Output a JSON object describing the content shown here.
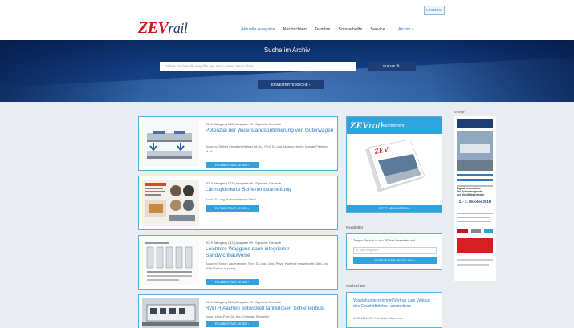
{
  "header": {
    "login_label": "LOGIN ≫",
    "logo_zev": "ZEV",
    "logo_rail": "rail",
    "nav": [
      {
        "label": "Aktuelle Ausgabe"
      },
      {
        "label": "Nachrichten"
      },
      {
        "label": "Termine"
      },
      {
        "label": "Sonderhefte"
      },
      {
        "label": "Service ⌄"
      },
      {
        "label": "Archiv ›"
      }
    ]
  },
  "hero": {
    "title": "Suche im Archiv",
    "search_placeholder": "Geben Sie hier die Begriffe ein, nach denen Sie suchen",
    "search_button": "SUCHE 🔍",
    "advanced_button": "ERWEITERTE SUCHE ›"
  },
  "articles": [
    {
      "meta": "2019 Jahrgang 143 | Ausgabe 09 | Sprache: Deutsch",
      "title": "Potenzial der Widerstandsoptimierung von Güterwagen",
      "authors": "Autoren: Stefan Christian Hellwig, M.Sc.; Prof. Dr.-Ing. Markus Hecht; Marian Fleming, M.Sc.",
      "button": "FACHBEITRAG LESEN ›"
    },
    {
      "meta": "2019 Jahrgang 143 | Ausgabe 09 | Sprache: Deutsch",
      "title": "Lärmoptimierte Schienenbearbeitung",
      "authors": "Autor: Dr.-Ing. Konstantin von Diest",
      "button": "FACHBEITRAG LESEN ›"
    },
    {
      "meta": "2019 Jahrgang 143 | Ausgabe 09 | Sprache: Deutsch",
      "title": "Leichtere Waggons dank integrierter Sandwichbauweise",
      "authors": "Autoren: Simon Laufenegger; Prof. Dr.-Ing.; Dipl.-Phys. Hartmut Hesselbarth; Dipl.-Ing. (FH) Markus Hartwig",
      "button": "FACHBEITRAG LESEN ›"
    },
    {
      "meta": "2019 Jahrgang 143 | Ausgabe 09 | Sprache: Deutsch",
      "title": "RWTH Aachen entwickelt fahrerlosen Schienenbus",
      "authors": "Autor: Univ.-Prof. Dr.-Ing. Christian Schindler",
      "button": "FACHBEITRAG LESEN ›"
    }
  ],
  "abo": {
    "logo_zev": "ZEV",
    "logo_rail": "rail",
    "subtitle": "Abonnement",
    "button": "JETZT ABONNIEREN ›"
  },
  "newsletter": {
    "heading": "Newsletter",
    "text": "Tragen Sie sich in den ZEVrail-Newsletter ein!",
    "placeholder": "E-Mail eingeben",
    "button": "NEWSLETTER BESTELLEN ›"
  },
  "news": {
    "heading": "Nachrichten",
    "title": "Vossloh unterzeichnet Vertrag zum Verkauf des Geschäftsfelds Locomotives",
    "meta": "10.09.2019 | Die Frankfurter Allgemeine ..."
  },
  "ad": {
    "label": "Anzeige",
    "lines": [
      "Digital Innovations",
      "Die Zukunftsagenda",
      "der Mobilitätsbranche"
    ],
    "date": "1. - 2. Oktober 2019"
  },
  "colors": {
    "accent": "#2ea3dc",
    "link": "#2b7cc4",
    "brand_red": "#c7161e",
    "navy": "#1c3f78"
  }
}
